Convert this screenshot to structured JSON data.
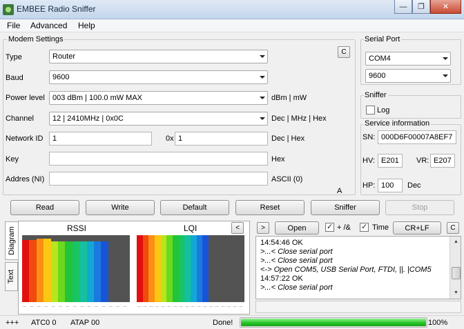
{
  "window": {
    "title": "EMBEE Radio Sniffer",
    "minimize_glyph": "—",
    "restore_glyph": "❐",
    "close_glyph": "✕"
  },
  "menu": {
    "items": [
      "File",
      "Advanced",
      "Help"
    ]
  },
  "modem_settings": {
    "title": "Modem Settings",
    "clear_button": "C",
    "type_label": "Type",
    "type_value": "Router",
    "baud_label": "Baud",
    "baud_value": "9600",
    "power_label": "Power level",
    "power_value": "003 dBm  |  100.0 mW MAX",
    "power_units": "dBm | mW",
    "channel_label": "Channel",
    "channel_value": "12   |   2410MHz   |   0x0C",
    "channel_units": "Dec  |  MHz  |  Hex",
    "network_label": "Network ID",
    "network_dec": "1",
    "network_hex_prefix": "0x",
    "network_hex": "1",
    "network_units": "Dec  |  Hex",
    "key_label": "Key",
    "key_value": "",
    "key_units": "Hex",
    "addr_label": "Addres (NI)",
    "addr_value": "",
    "addr_units": "ASCII (0)",
    "mode_indicator": "A"
  },
  "serial_port": {
    "title": "Serial Port",
    "port_value": "COM4",
    "baud_value": "9600"
  },
  "sniffer": {
    "title": "Sniffer",
    "log_label": "Log",
    "log_checked": false
  },
  "service_info": {
    "title": "Service information",
    "sn_label": "SN:",
    "sn_value": "000D6F00007A8EF7",
    "hv_label": "HV:",
    "hv_value": "E201",
    "vr_label": "VR:",
    "vr_value": "E207",
    "hp_label": "HP:",
    "hp_value": "100",
    "hp_unit": "Dec"
  },
  "actions": [
    "Read",
    "Write",
    "Default",
    "Reset",
    "Sniffer",
    "Stop"
  ],
  "tabs": {
    "diagram": "Diagram",
    "text": "Text"
  },
  "diagram": {
    "rssi_label": "RSSI",
    "lqi_label": "LQI",
    "collapse_button": "<",
    "rssi_levels": [
      0.93,
      0.93,
      0.95,
      0.95,
      0.91,
      0.91,
      0.91,
      0.91,
      0.91,
      0.91,
      0.91,
      0.91,
      0,
      0,
      0
    ],
    "lqi_levels": [
      1,
      1,
      1,
      1,
      1,
      1,
      1,
      1,
      1,
      1,
      1,
      1,
      1,
      1,
      0,
      0,
      0,
      0
    ],
    "colors": [
      "#e30f0f",
      "#f04a10",
      "#fb8f13",
      "#fcc713",
      "#b6e61c",
      "#6cd81e",
      "#22c43a",
      "#18c463",
      "#15c09c",
      "#12a8d3",
      "#1b7ae0",
      "#1a54d6",
      "#535353",
      "#535353",
      "#535353",
      "#535353",
      "#535353",
      "#535353"
    ],
    "dots": "......"
  },
  "console": {
    "expand_button": ">",
    "open_button": "Open",
    "plus_label": "+ /&",
    "plus_checked": true,
    "time_label": "Time",
    "time_checked": true,
    "crlf_button": "CR+LF",
    "clear_button": "C",
    "lines": [
      "14:54:46   OK",
      ">...< Close serial port",
      ">...< Close serial port",
      "<-> Open COM5,  USB Serial Port,    FTDI,    ||. |COM5",
      "14:57:22   OK",
      ">...< Close serial port"
    ]
  },
  "status": {
    "plus": "+++",
    "atc": "ATC0 0",
    "atap": "ATAP 00",
    "done": "Done!",
    "progress": 100,
    "progress_text": "100%"
  }
}
